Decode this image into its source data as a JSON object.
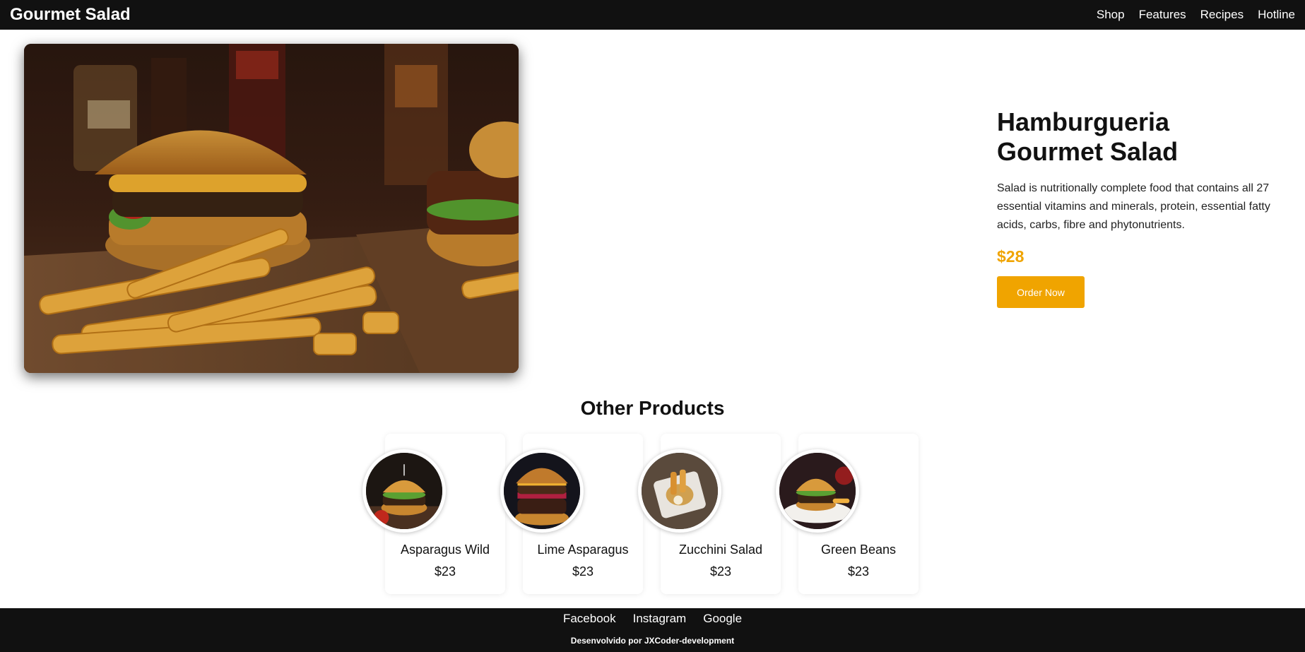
{
  "navbar": {
    "brand": "Gourmet Salad",
    "links": [
      "Shop",
      "Features",
      "Recipes",
      "Hotline"
    ]
  },
  "hero": {
    "title_line1": "Hamburgueria",
    "title_line2": "Gourmet Salad",
    "description": "Salad is nutritionally complete food that contains all 27 essential vitamins and minerals, protein, essential fatty acids, carbs, fibre and phytonutrients.",
    "price": "$28",
    "order_label": "Order Now"
  },
  "other_products": {
    "title": "Other Products",
    "items": [
      {
        "name": "Asparagus Wild",
        "price": "$23"
      },
      {
        "name": "Lime Asparagus",
        "price": "$23"
      },
      {
        "name": "Zucchini Salad",
        "price": "$23"
      },
      {
        "name": "Green Beans",
        "price": "$23"
      }
    ]
  },
  "footer": {
    "links": [
      "Facebook",
      "Instagram",
      "Google"
    ],
    "credit": "Desenvolvido por JXCoder-development"
  },
  "colors": {
    "accent": "#f0a400",
    "nav_bg": "#111111",
    "footer_bg": "#111111"
  }
}
